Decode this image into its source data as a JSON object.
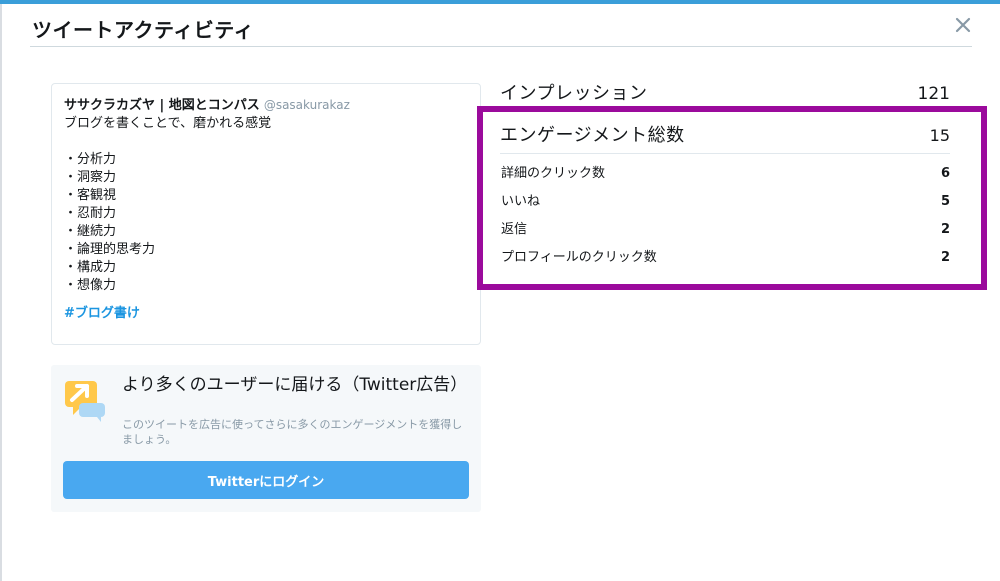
{
  "header": {
    "title": "ツイートアクティビティ",
    "close_symbol": "✕",
    "close_icon": "close-icon",
    "accent_color": "#3a9ed9"
  },
  "tweet": {
    "author": "ササクラカズヤ | 地図とコンパス",
    "handle": "@sasakurakaz",
    "lines": [
      "ブログを書くことで、磨かれる感覚",
      "",
      "・分析力",
      "・洞察力",
      "・客観視",
      "・忍耐力",
      "・継続力",
      "・論理的思考力",
      "・構成力",
      "・想像力"
    ],
    "hashtag": "#ブログ書け",
    "hashtag_color": "#1b95e0"
  },
  "promo": {
    "icon": "promote-arrow-icon",
    "title": "より多くのユーザーに届ける（Twitter広告）",
    "description": "このツイートを広告に使ってさらに多くのエンゲージメントを獲得しましょう。",
    "button_label": "Twitterにログイン",
    "button_color": "#49a8f0"
  },
  "metrics": {
    "impressions": {
      "label": "インプレッション",
      "value": "121"
    },
    "engagements": {
      "label": "エンゲージメント総数",
      "value": "15"
    },
    "breakdown": [
      {
        "label": "詳細のクリック数",
        "value": "6"
      },
      {
        "label": "いいね",
        "value": "5"
      },
      {
        "label": "返信",
        "value": "2"
      },
      {
        "label": "プロフィールのクリック数",
        "value": "2"
      }
    ],
    "highlight_color": "#9b0a9c"
  }
}
